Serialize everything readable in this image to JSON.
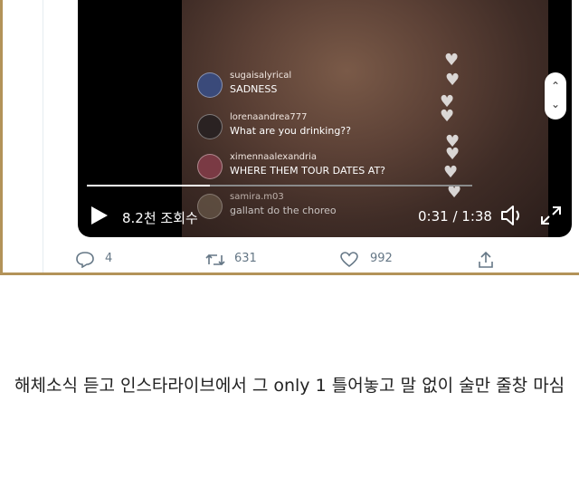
{
  "video": {
    "comments": [
      {
        "user": "sugaisalyrical",
        "text": "SADNESS",
        "avatar_color": "#3a4a7a"
      },
      {
        "user": "lorenaandrea777",
        "text": "What are you drinking??",
        "avatar_color": "#2a2222"
      },
      {
        "user": "ximennaalexandria",
        "text": "WHERE THEM TOUR DATES AT?",
        "avatar_color": "#7a3a44"
      },
      {
        "user": "samira.m03",
        "text": "gallant do the choreo",
        "avatar_color": "#6a5a4a"
      }
    ],
    "views": "8.2천 조회수",
    "time": "0:31 / 1:38",
    "progress_fraction": 0.32
  },
  "actions": {
    "reply_count": "4",
    "retweet_count": "631",
    "like_count": "992"
  },
  "caption": {
    "text": "해체소식 듣고 인스타라이브에서 그 only 1 틀어놓고 말 없이 술만 줄창 마심"
  },
  "colors": {
    "frame_border": "#b39359",
    "action_gray": "#657786"
  }
}
